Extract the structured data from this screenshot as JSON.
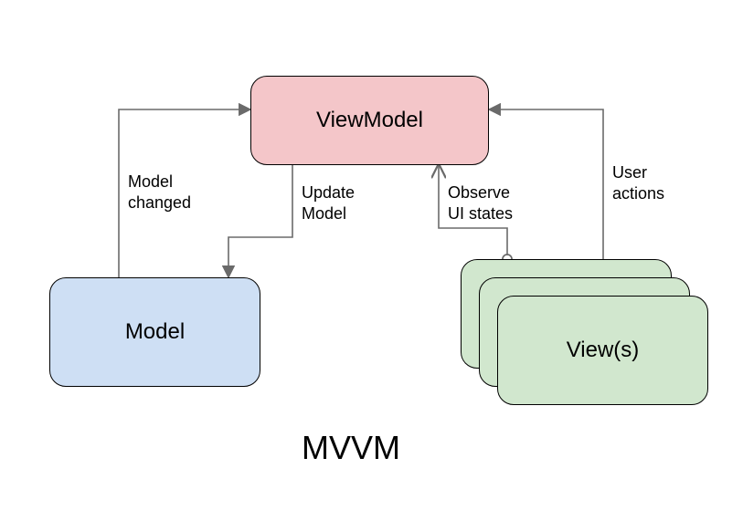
{
  "nodes": {
    "viewmodel": "ViewModel",
    "model": "Model",
    "views": "View(s)"
  },
  "edges": {
    "model_changed": "Model\nchanged",
    "update_model": "Update\nModel",
    "observe_ui": "Observe\nUI states",
    "user_actions": "User\nactions"
  },
  "title": "MVVM"
}
